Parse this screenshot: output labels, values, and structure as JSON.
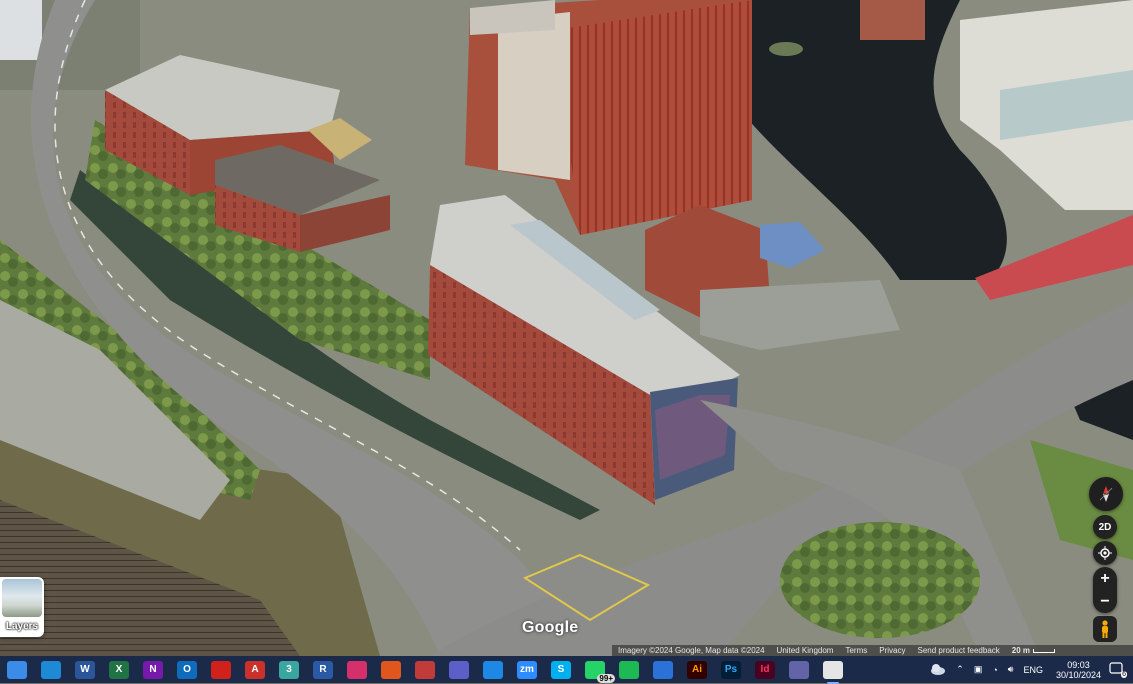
{
  "map": {
    "layers_label": "Layers",
    "view_mode": "2D",
    "google_logo": "Google",
    "footer": {
      "imagery": "Imagery ©2024 Google, Map data ©2024",
      "region": "United Kingdom",
      "terms": "Terms",
      "privacy": "Privacy",
      "feedback": "Send product feedback",
      "scale": "20 m"
    }
  },
  "taskbar": {
    "apps": [
      {
        "name": "start",
        "glyph": "",
        "color": "#3b8be8"
      },
      {
        "name": "mail",
        "glyph": "",
        "color": "#1e8ad6"
      },
      {
        "name": "word",
        "glyph": "W",
        "color": "#2b579a"
      },
      {
        "name": "excel",
        "glyph": "X",
        "color": "#217346"
      },
      {
        "name": "onenote",
        "glyph": "N",
        "color": "#7719aa"
      },
      {
        "name": "outlook",
        "glyph": "O",
        "color": "#0f6cbd"
      },
      {
        "name": "acrobat",
        "glyph": "",
        "color": "#d0211b"
      },
      {
        "name": "access",
        "glyph": "A",
        "color": "#c9312a"
      },
      {
        "name": "app-3",
        "glyph": "3",
        "color": "#3aa6a0"
      },
      {
        "name": "app-r",
        "glyph": "R",
        "color": "#2a5aa5"
      },
      {
        "name": "instagram",
        "glyph": "",
        "color": "#d6306c"
      },
      {
        "name": "app-orange",
        "glyph": "",
        "color": "#e0561c"
      },
      {
        "name": "app-cube",
        "glyph": "",
        "color": "#c23b3b"
      },
      {
        "name": "teams",
        "glyph": "",
        "color": "#5b5fc7"
      },
      {
        "name": "app-chat",
        "glyph": "",
        "color": "#1e88e5"
      },
      {
        "name": "zoom",
        "glyph": "zm",
        "color": "#2d8cff"
      },
      {
        "name": "skype",
        "glyph": "S",
        "color": "#00aff0"
      },
      {
        "name": "whatsapp",
        "glyph": "",
        "color": "#25d366",
        "badge": "99+"
      },
      {
        "name": "spotify",
        "glyph": "",
        "color": "#1db954"
      },
      {
        "name": "app-v",
        "glyph": "",
        "color": "#2a72d8"
      },
      {
        "name": "illustrator",
        "glyph": "Ai",
        "color": "#330000",
        "fg": "#ff9a00"
      },
      {
        "name": "photoshop",
        "glyph": "Ps",
        "color": "#001e36",
        "fg": "#31a8ff"
      },
      {
        "name": "indesign",
        "glyph": "Id",
        "color": "#49021f",
        "fg": "#ff3366"
      },
      {
        "name": "teams-2",
        "glyph": "",
        "color": "#6264a7"
      },
      {
        "name": "chrome",
        "glyph": "",
        "color": "#e5e5e5",
        "active": true
      }
    ],
    "tray": {
      "language": "ENG",
      "time": "09:03",
      "date": "30/10/2024",
      "notifications": "6"
    }
  }
}
